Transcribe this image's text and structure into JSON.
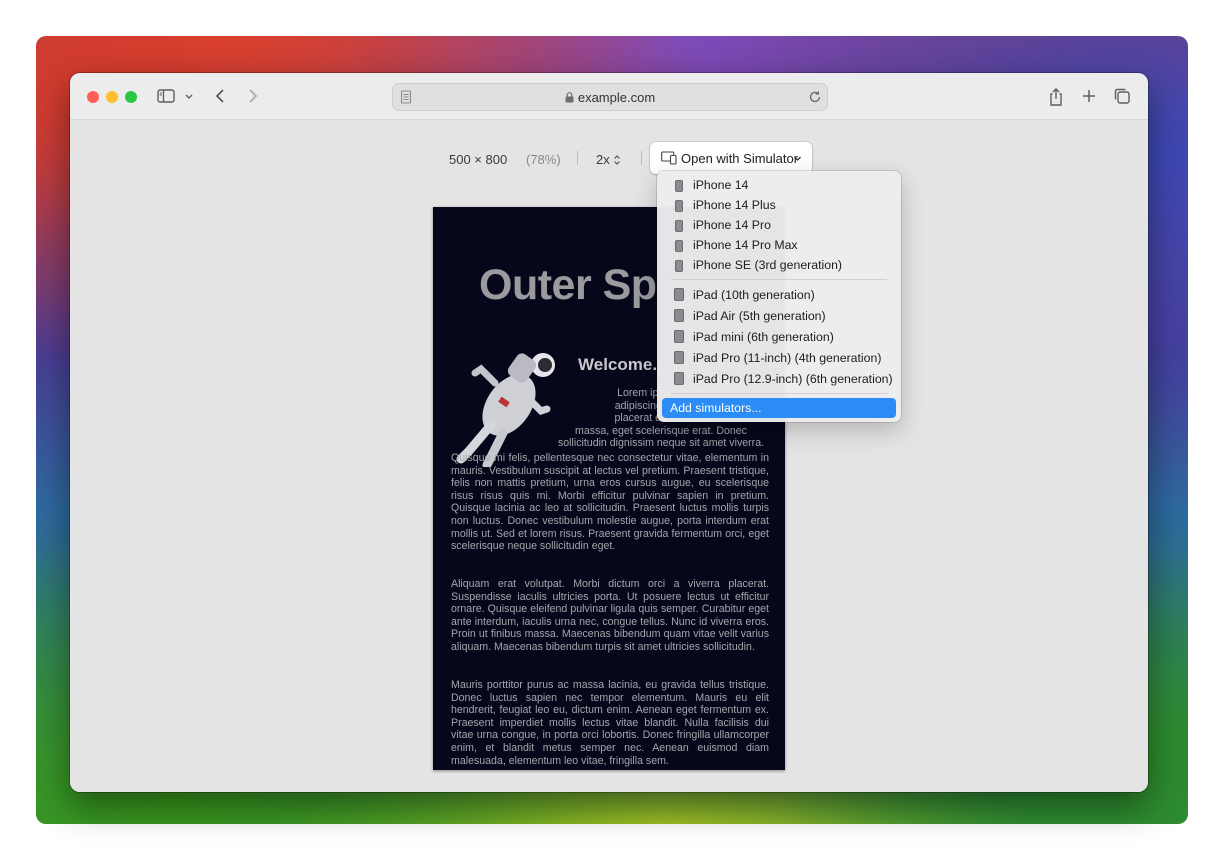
{
  "browser": {
    "address": "example.com",
    "controls": {
      "viewport_size": "500 × 800",
      "zoom": "(78%)",
      "scale": "2x",
      "simulator_button": "Open with Simulator"
    }
  },
  "page": {
    "title": "Outer Sp",
    "welcome": "Welcome..",
    "intro_lines": [
      "Lorem ipsum dolor",
      "adipiscing elit. Cura",
      "placerat elementum",
      "massa, eget scelerisque erat. Donec",
      "sollicitudin dignissim neque sit amet viverra."
    ],
    "paragraph1": "Quisque mi felis, pellentesque nec consectetur vitae, elementum in mauris. Vestibulum suscipit at lectus vel pretium. Praesent tristique, felis non mattis pretium, urna eros cursus augue, eu scelerisque risus risus quis mi. Morbi efficitur pulvinar sapien in pretium. Quisque lacinia ac leo at sollicitudin. Praesent luctus mollis turpis non luctus. Donec vestibulum molestie augue, porta interdum erat mollis ut. Sed et lorem risus. Praesent gravida fermentum orci, eget scelerisque neque sollicitudin eget.",
    "paragraph2": "Aliquam erat volutpat. Morbi dictum orci a viverra placerat. Suspendisse iaculis ultricies porta. Ut posuere lectus ut efficitur ornare. Quisque eleifend pulvinar ligula quis semper. Curabitur eget ante interdum, iaculis urna nec, congue tellus. Nunc id viverra eros. Proin ut finibus massa. Maecenas bibendum quam vitae velit varius aliquam. Maecenas bibendum turpis sit amet ultricies sollicitudin.",
    "paragraph3": "Mauris porttitor purus ac massa lacinia, eu gravida tellus tristique. Donec luctus sapien nec tempor elementum. Mauris eu elit hendrerit, feugiat leo eu, dictum enim. Aenean eget fermentum ex. Praesent imperdiet mollis lectus vitae blandit. Nulla facilisis dui vitae urna congue, in porta orci lobortis. Donec fringilla ullamcorper enim, et blandit metus semper nec. Aenean euismod diam malesuada, elementum leo vitae, fringilla sem."
  },
  "menu": {
    "iphones": [
      "iPhone 14",
      "iPhone 14 Plus",
      "iPhone 14 Pro",
      "iPhone 14 Pro Max",
      "iPhone SE (3rd generation)"
    ],
    "ipads": [
      "iPad (10th generation)",
      "iPad Air (5th generation)",
      "iPad mini (6th generation)",
      "iPad Pro (11-inch) (4th generation)",
      "iPad Pro (12.9-inch) (6th generation)"
    ],
    "add": "Add simulators..."
  },
  "colors": {
    "close": "#ff5f57",
    "minimize": "#febc2e",
    "maximize": "#28c840",
    "accent": "#2a8cf4"
  },
  "icons": [
    "sidebar-icon",
    "chevron-down-icon",
    "back-icon",
    "forward-icon",
    "reader-icon",
    "lock-icon",
    "reload-icon",
    "share-icon",
    "new-tab-icon",
    "tab-overview-icon",
    "device-icon",
    "phone-icon",
    "tablet-icon"
  ]
}
